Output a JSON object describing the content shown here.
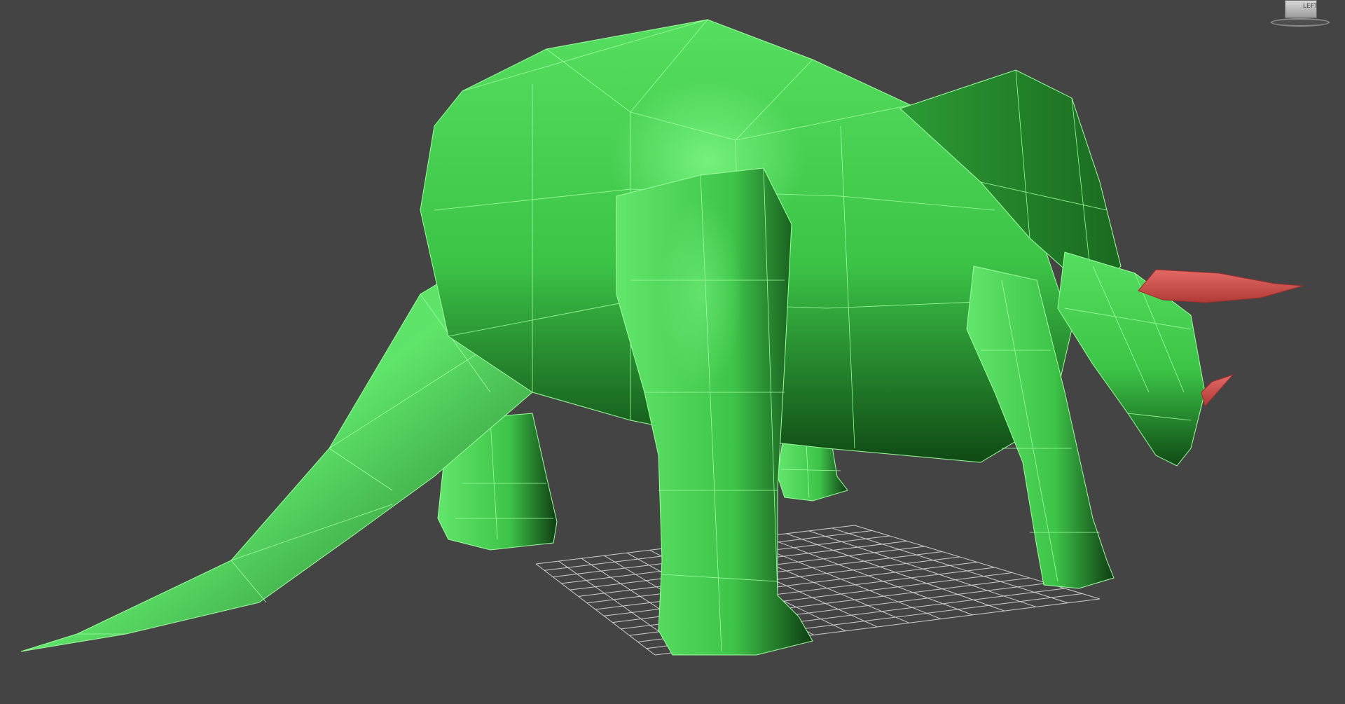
{
  "viewport": {
    "background": "#444444",
    "view_label": "",
    "shading": "smooth-with-wireframe"
  },
  "viewcube": {
    "face_label": "LEFT",
    "icon": "viewcube-icon"
  },
  "scene": {
    "model": "triceratops",
    "body_color": "#3ec44a",
    "highlight_color": "#6cf076",
    "shadow_color": "#0c3a10",
    "wire_color": "#9dff9d",
    "horn_color": "#d9524f",
    "grid_color": "#cfcfcf"
  }
}
